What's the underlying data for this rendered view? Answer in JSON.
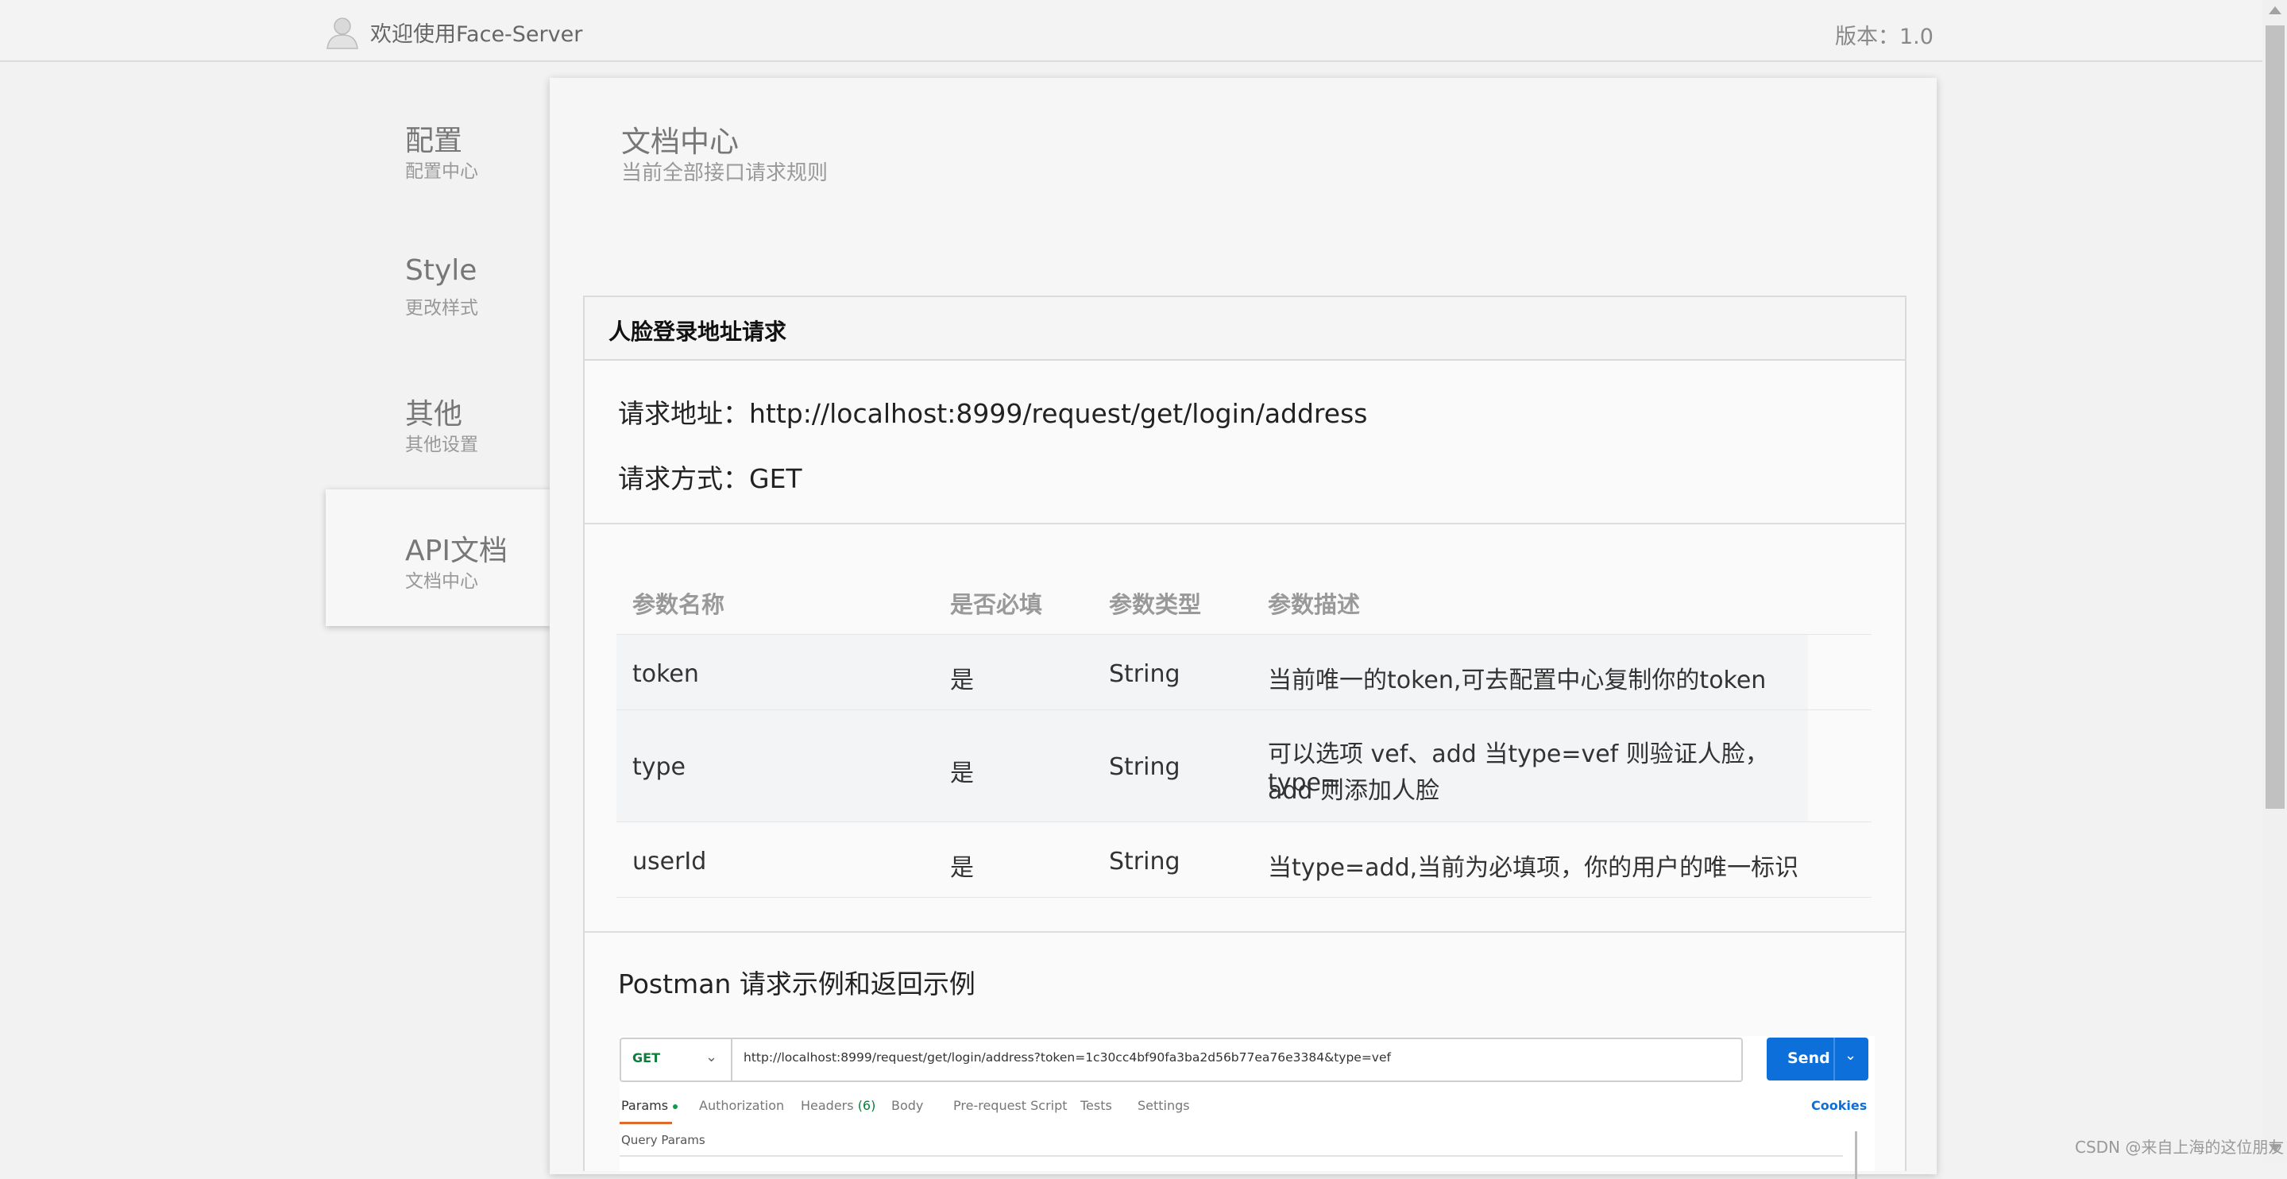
{
  "header": {
    "welcome": "欢迎使用Face-Server",
    "version": "版本：1.0"
  },
  "sidebar": {
    "items": [
      {
        "title": "配置",
        "sub": "配置中心"
      },
      {
        "title": "Style",
        "sub": "更改样式"
      },
      {
        "title": "其他",
        "sub": "其他设置"
      },
      {
        "title": "API文档",
        "sub": "文档中心"
      }
    ]
  },
  "main": {
    "title": "文档中心",
    "subtitle": "当前全部接口请求规则"
  },
  "panel": {
    "heading": "人脸登录地址请求",
    "request_url": "请求地址：http://localhost:8999/request/get/login/address",
    "request_method": "请求方式：GET"
  },
  "params": {
    "headers": [
      "参数名称",
      "是否必填",
      "参数类型",
      "参数描述"
    ],
    "rows": [
      [
        "token",
        "是",
        "String",
        "当前唯一的token,可去配置中心复制你的token"
      ],
      [
        "type",
        "是",
        "String",
        "可以选项 vef、add 当type=vef 则验证人脸，type=",
        "add 则添加人脸"
      ],
      [
        "userId",
        "是",
        "String",
        "当type=add,当前为必填项，你的用户的唯一标识"
      ]
    ]
  },
  "postman": {
    "title": "Postman 请求示例和返回示例",
    "method": "GET",
    "url": "http://localhost:8999/request/get/login/address?token=1c30cc4bf90fa3ba2d56b77ea76e3384&type=vef",
    "send": "Send",
    "tabs": {
      "params": "Params",
      "authorization": "Authorization",
      "headers": "Headers",
      "headers_count": "(6)",
      "body": "Body",
      "prerequest": "Pre-request Script",
      "tests": "Tests",
      "settings": "Settings"
    },
    "cookies": "Cookies",
    "query_params": "Query Params"
  },
  "watermark": "CSDN @来自上海的这位朋友"
}
